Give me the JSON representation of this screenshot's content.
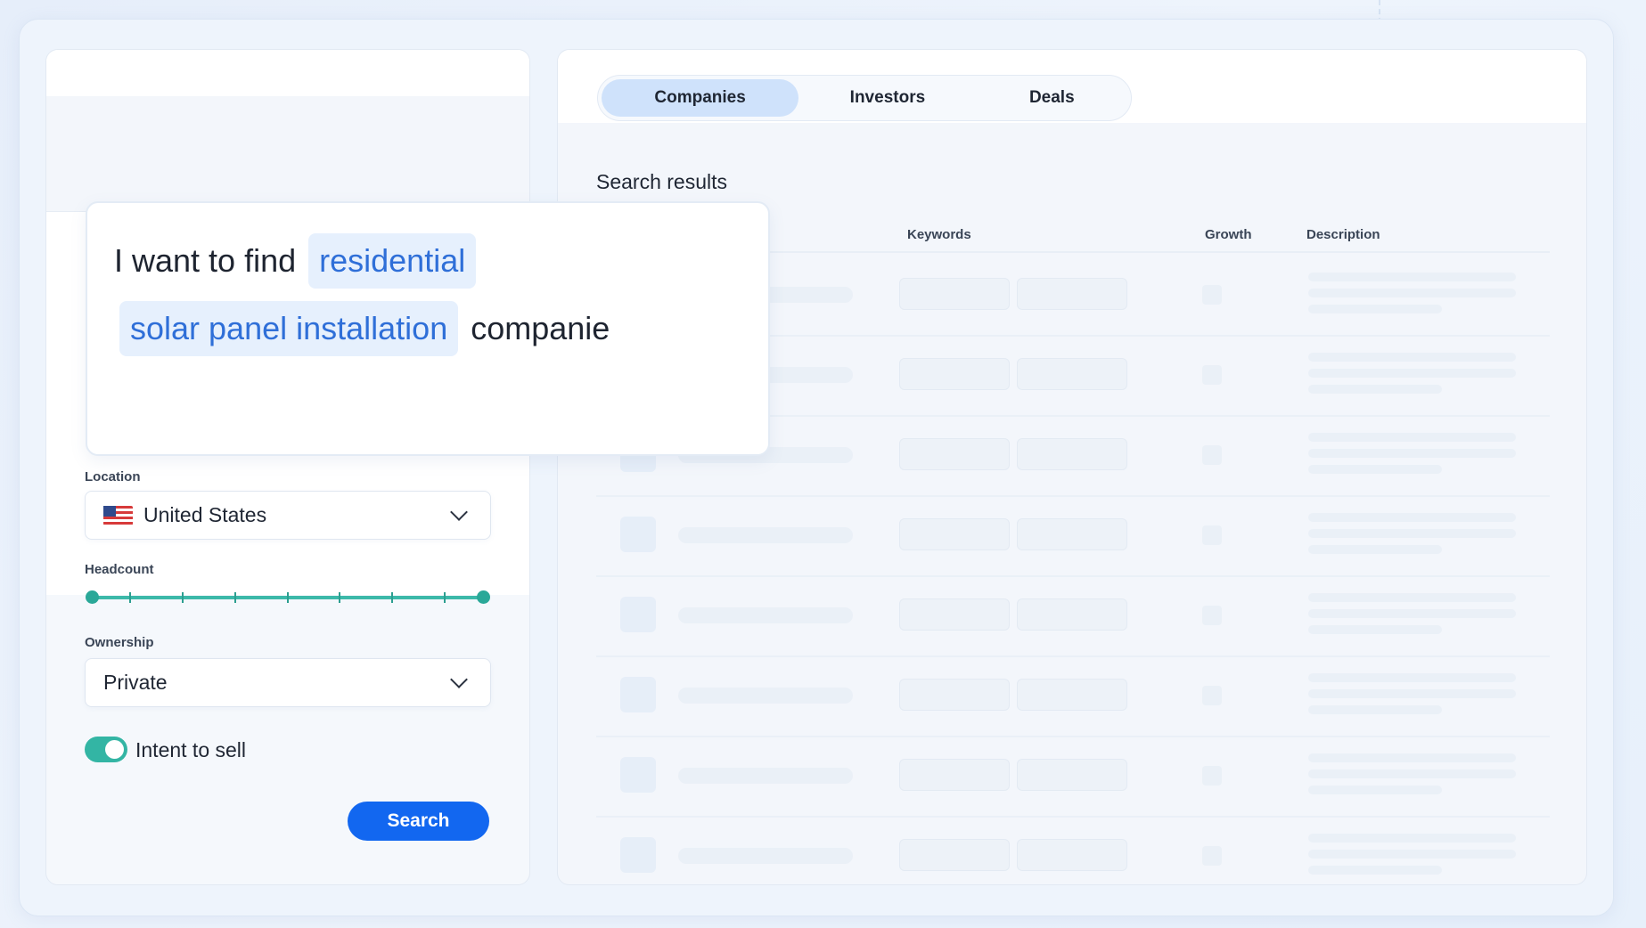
{
  "tabs": [
    {
      "label": "Companies",
      "active": true
    },
    {
      "label": "Investors",
      "active": false
    },
    {
      "label": "Deals",
      "active": false
    }
  ],
  "query": {
    "prefix": "I want to find",
    "chip1": "residential",
    "chip2": "solar panel installation",
    "suffix": "companie"
  },
  "filters": {
    "location_label": "Location",
    "location_value": "United States",
    "headcount_label": "Headcount",
    "headcount_range": [
      0,
      1
    ],
    "ownership_label": "Ownership",
    "ownership_value": "Private",
    "intent_label": "Intent to sell",
    "intent_on": true
  },
  "search_button": "Search",
  "results": {
    "title": "Search results",
    "columns": {
      "keywords": "Keywords",
      "growth": "Growth",
      "description": "Description"
    }
  },
  "colors": {
    "primary": "#1267f0",
    "accent_teal": "#33b5a4",
    "chip_bg": "#e6f0fd",
    "chip_text": "#2f6fd8"
  },
  "icons": {
    "location_flag": "us-flag-icon",
    "dropdown": "chevron-down-icon"
  }
}
